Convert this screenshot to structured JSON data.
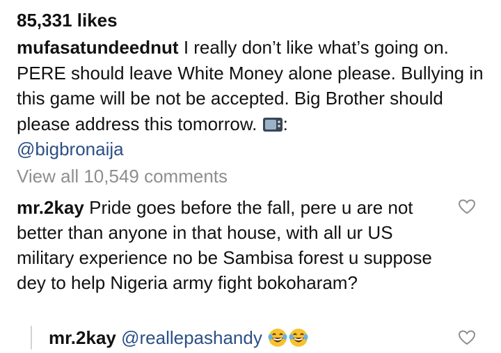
{
  "post": {
    "likes": "85,331 likes",
    "caption_user": "mufasatundeednut",
    "caption_text": "I really don’t like what’s going on. PERE should leave White Money alone please. Bullying in this game will be not be accepted. Big Brother should please address this tomorrow.",
    "caption_icon": "television-icon",
    "caption_colon": ":",
    "caption_mention": "@bigbronaija",
    "view_all": "View all 10,549 comments"
  },
  "comments": [
    {
      "user": "mr.2kay",
      "text": "Pride goes before the fall, pere u are not better than anyone in that house, with all ur US military experience no be Sambisa forest u suppose dey to help Nigeria army fight bokoharam?",
      "like_icon": "heart-icon"
    }
  ],
  "reply": {
    "user": "mr.2kay",
    "mention": "@reallepashandy",
    "emojis": [
      "laughing-tears-emoji",
      "laughing-tears-emoji"
    ],
    "like_icon": "heart-icon"
  },
  "colors": {
    "text": "#111111",
    "muted": "#8e8e8e",
    "mention": "#2b4f86",
    "reply_bar": "#d4d4d4"
  }
}
